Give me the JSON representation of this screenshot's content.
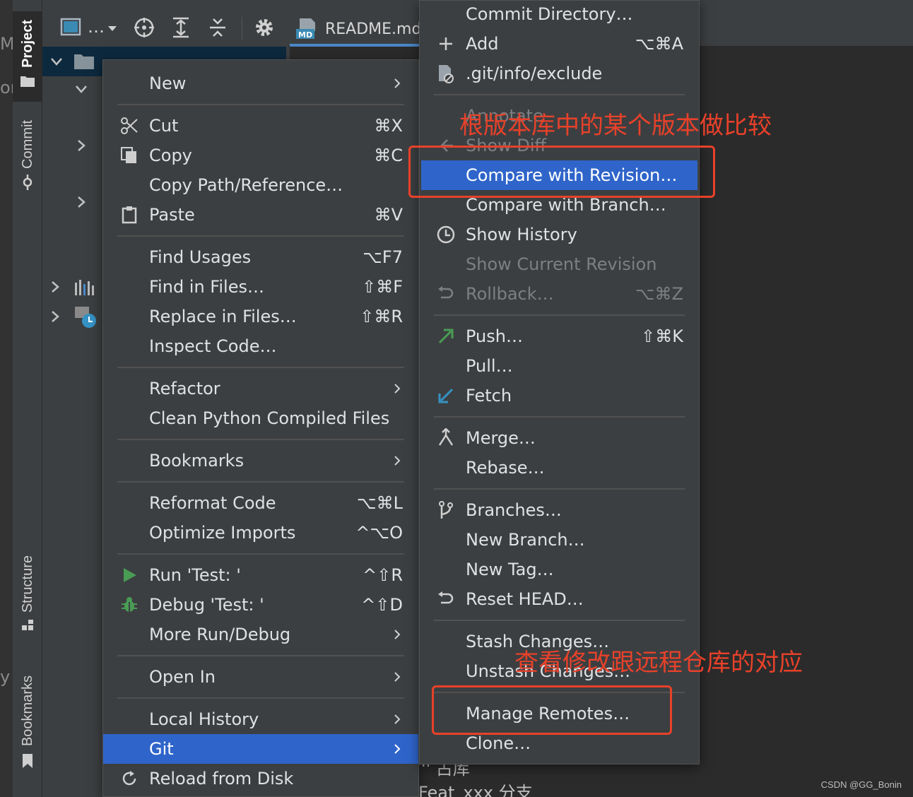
{
  "sidebar": {
    "top_tabs": [
      {
        "label": "Project",
        "icon": "folder-icon",
        "active": true
      },
      {
        "label": "Commit",
        "icon": "commit-icon",
        "active": false
      }
    ],
    "bottom_tabs": [
      {
        "label": "Structure",
        "icon": "structure-icon"
      },
      {
        "label": "Bookmarks",
        "icon": "bookmark-icon"
      }
    ]
  },
  "editor_tab": {
    "label": "README.md",
    "badge": "MD"
  },
  "edge_fragments": [
    "M",
    "or",
    "y"
  ],
  "project_toolbar": {
    "dropdown_label": "…"
  },
  "context_menu": {
    "items": [
      {
        "label": "New",
        "submenu": true
      },
      {
        "label": "Cut",
        "shortcut": "⌘X",
        "icon": "scissors-icon"
      },
      {
        "label": "Copy",
        "shortcut": "⌘C",
        "icon": "copy-icon"
      },
      {
        "label": "Copy Path/Reference…"
      },
      {
        "label": "Paste",
        "shortcut": "⌘V",
        "icon": "clipboard-icon"
      },
      {
        "label": "Find Usages",
        "shortcut": "⌥F7"
      },
      {
        "label": "Find in Files…",
        "shortcut": "⇧⌘F"
      },
      {
        "label": "Replace in Files…",
        "shortcut": "⇧⌘R"
      },
      {
        "label": "Inspect Code…"
      },
      {
        "label": "Refactor",
        "submenu": true
      },
      {
        "label": "Clean Python Compiled Files"
      },
      {
        "label": "Bookmarks",
        "submenu": true
      },
      {
        "label": "Reformat Code",
        "shortcut": "⌥⌘L"
      },
      {
        "label": "Optimize Imports",
        "shortcut": "^⌥O"
      },
      {
        "label": "Run 'Test: '",
        "shortcut": "^⇧R",
        "icon": "run-icon"
      },
      {
        "label": "Debug 'Test: '",
        "shortcut": "^⇧D",
        "icon": "debug-icon"
      },
      {
        "label": "More Run/Debug",
        "submenu": true
      },
      {
        "label": "Open In",
        "submenu": true
      },
      {
        "label": "Local History",
        "submenu": true
      },
      {
        "label": "Git",
        "submenu": true,
        "selected": true
      },
      {
        "label": "Reload from Disk",
        "icon": "reload-icon"
      }
    ]
  },
  "git_menu": {
    "items": [
      {
        "label": "Commit Directory…"
      },
      {
        "label": "Add",
        "shortcut": "⌥⌘A",
        "icon": "plus-icon"
      },
      {
        "label": ".git/info/exclude",
        "icon": "git-ignore-icon"
      },
      {
        "label": "Annotate",
        "disabled": true
      },
      {
        "label": "Show Diff",
        "disabled": true,
        "icon": "diff-icon"
      },
      {
        "label": "Compare with Revision…",
        "selected": true
      },
      {
        "label": "Compare with Branch…"
      },
      {
        "label": "Show History",
        "icon": "clock-icon"
      },
      {
        "label": "Show Current Revision",
        "disabled": true
      },
      {
        "label": "Rollback…",
        "shortcut": "⌥⌘Z",
        "disabled": true,
        "icon": "rollback-icon"
      },
      {
        "label": "Push…",
        "shortcut": "⇧⌘K",
        "icon": "push-icon"
      },
      {
        "label": "Pull…"
      },
      {
        "label": "Fetch",
        "icon": "fetch-icon"
      },
      {
        "label": "Merge…",
        "icon": "merge-icon"
      },
      {
        "label": "Rebase…"
      },
      {
        "label": "Branches…",
        "icon": "branch-icon"
      },
      {
        "label": "New Branch…"
      },
      {
        "label": "New Tag…"
      },
      {
        "label": "Reset HEAD…",
        "icon": "reset-icon"
      },
      {
        "label": "Stash Changes…"
      },
      {
        "label": "Unstash Changes…"
      },
      {
        "label": "Manage Remotes…"
      },
      {
        "label": "Clone…"
      }
    ]
  },
  "annotations": {
    "compare_note": "根版本库中的某个版本做比较",
    "remotes_note": "查看修改跟远程仓库的对应"
  },
  "below_menu_text": [
    "'' 占库",
    "Feat_xxx 分支"
  ],
  "watermark": "CSDN @GG_Bonin",
  "colors": {
    "menu_bg": "#3c3f41",
    "selection": "#2f65ca",
    "annotation": "#e8412a",
    "run_green": "#499c54"
  }
}
